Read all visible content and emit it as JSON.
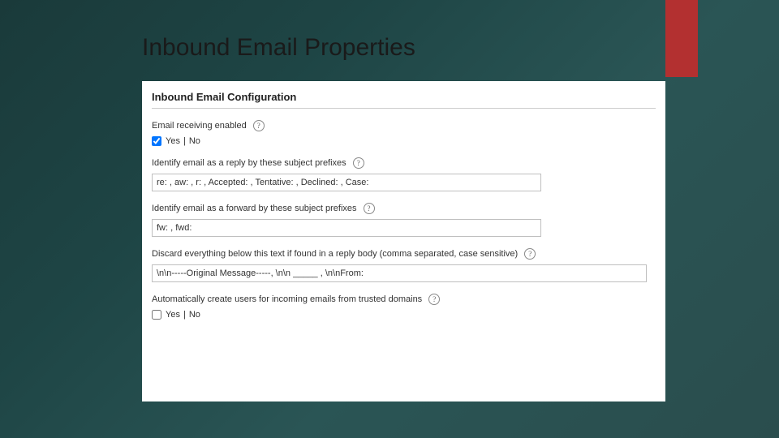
{
  "slide": {
    "title": "Inbound Email Properties"
  },
  "panel": {
    "heading": "Inbound Email Configuration"
  },
  "fields": {
    "receiving": {
      "label": "Email receiving enabled",
      "yes": "Yes",
      "sep": "|",
      "no": "No",
      "checked": true
    },
    "reply_prefixes": {
      "label": "Identify email as a reply by these subject prefixes",
      "value": "re: , aw: , r: , Accepted: , Tentative: , Declined: , Case:"
    },
    "forward_prefixes": {
      "label": "Identify email as a forward by these subject prefixes",
      "value": "fw: , fwd:"
    },
    "discard_below": {
      "label": "Discard everything below this text if found in a reply body (comma separated, case sensitive)",
      "value": "\\n\\n-----Original Message-----, \\n\\n _____ , \\n\\nFrom:"
    },
    "auto_create_users": {
      "label": "Automatically create users for incoming emails from trusted domains",
      "yes": "Yes",
      "sep": "|",
      "no": "No",
      "checked": false
    }
  },
  "help_glyph": "?"
}
